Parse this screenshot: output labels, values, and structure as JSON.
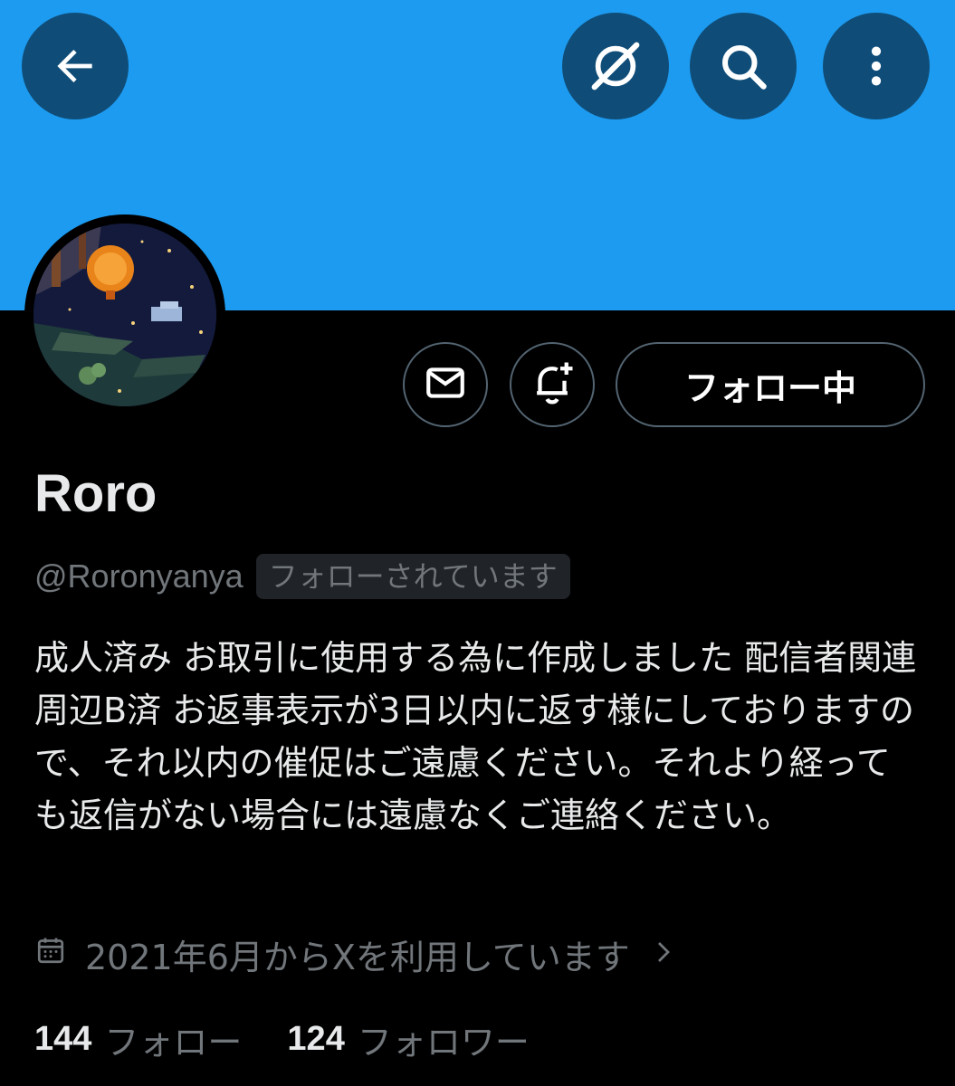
{
  "header": {
    "back_icon": "arrow-left-icon",
    "grok_icon": "grok-icon",
    "search_icon": "search-icon",
    "more_icon": "more-vertical-icon",
    "banner_color": "#1d9bf0"
  },
  "profile": {
    "avatar_icon": "avatar-image",
    "message_icon": "mail-icon",
    "notify_icon": "bell-plus-icon",
    "follow_button_label": "フォロー中",
    "display_name": "Roro",
    "handle": "@Roronyanya",
    "follows_you_badge": "フォローされています",
    "bio": "成人済み お取引に使用する為に作成しました 配信者関連周辺B済 お返事表示が3日以内に返す様にしておりますので、それ以内の催促はご遠慮ください。それより経っても返信がない場合には遠慮なくご連絡ください。",
    "joined_icon": "calendar-icon",
    "joined_text": "2021年6月からXを利用しています",
    "joined_chevron_icon": "chevron-right-icon"
  },
  "stats": {
    "following_count": "144",
    "following_label": "フォロー",
    "followers_count": "124",
    "followers_label": "フォロワー"
  }
}
